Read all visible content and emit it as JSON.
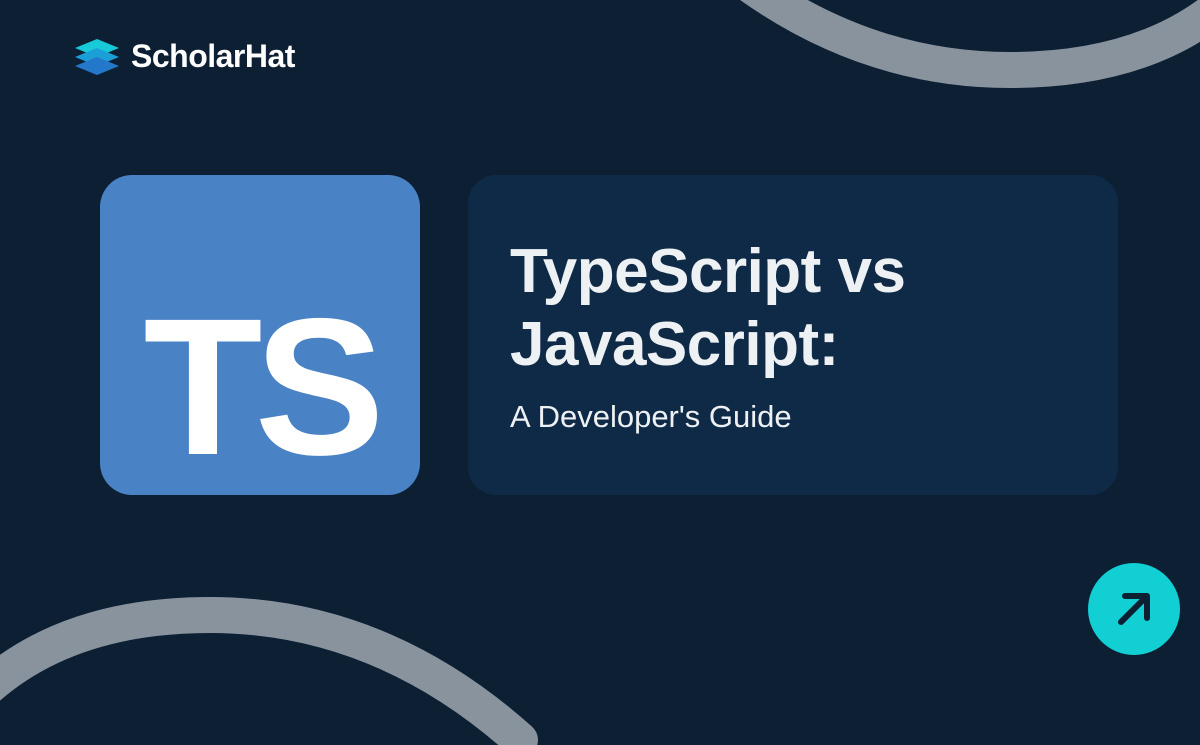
{
  "brand": {
    "name": "ScholarHat"
  },
  "badge": {
    "text": "TS"
  },
  "card": {
    "title": "TypeScript vs JavaScript:",
    "subtitle": "A Developer's Guide"
  }
}
